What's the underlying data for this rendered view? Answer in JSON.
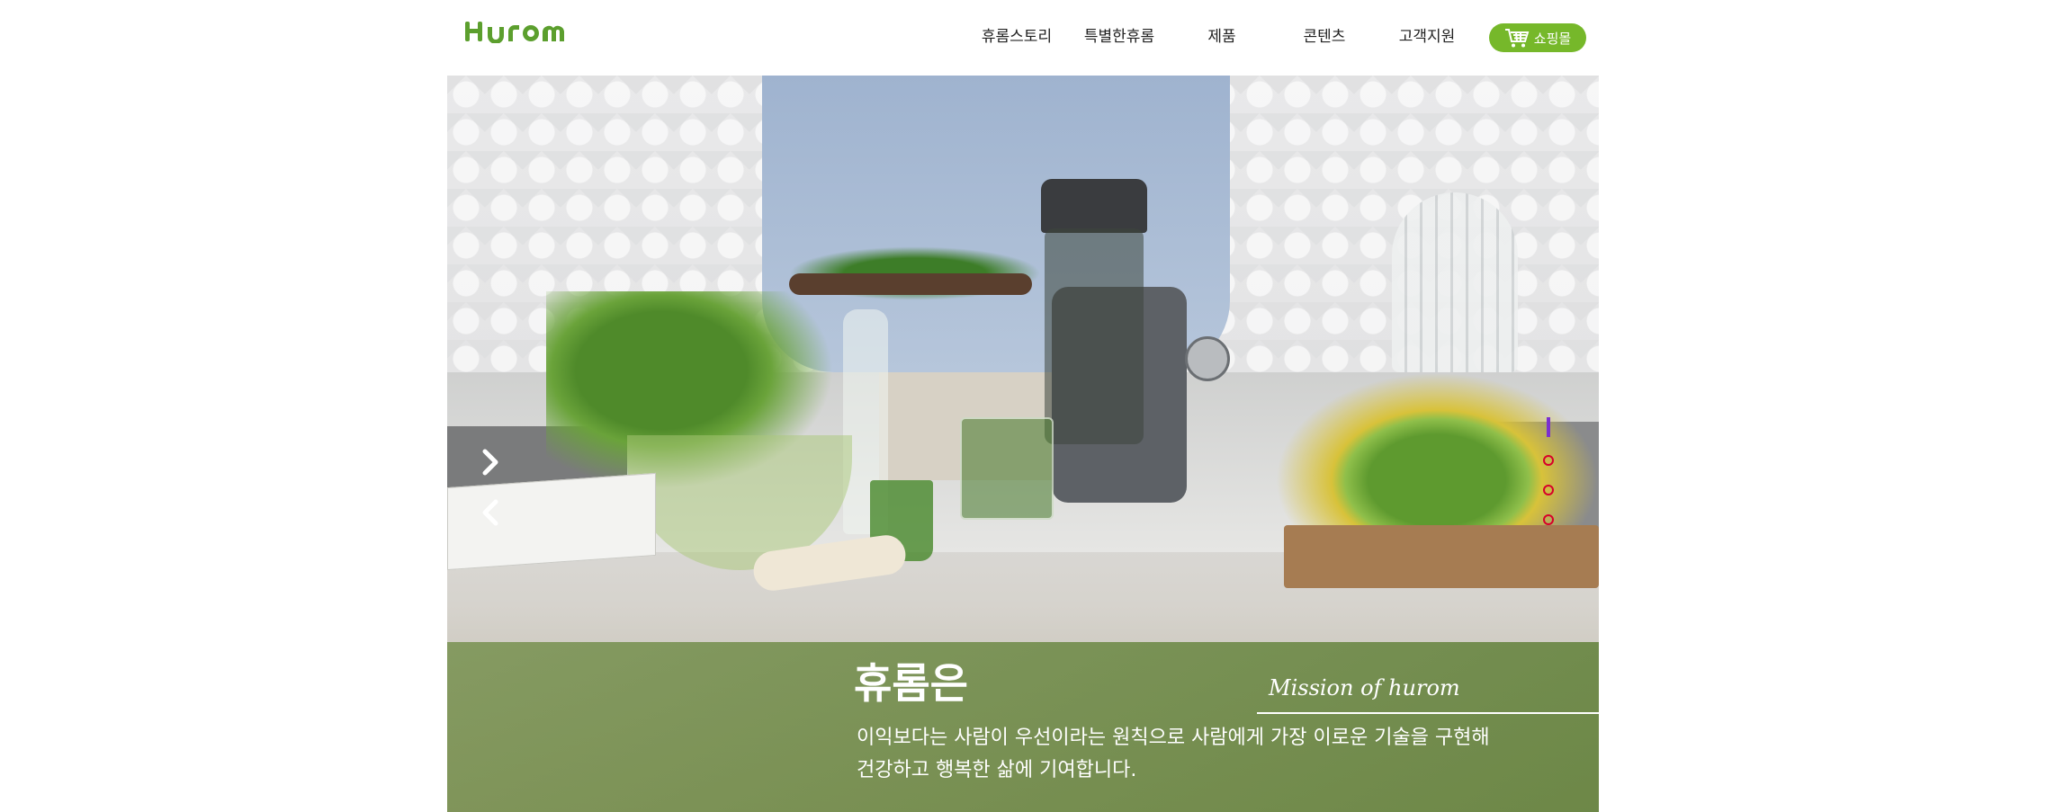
{
  "brand": {
    "logo_text": "HUROM",
    "accent_color": "#76b82a",
    "logo_color": "#5c9f2e"
  },
  "nav": {
    "items": [
      {
        "label": "휴롬스토리"
      },
      {
        "label": "특별한휴롬"
      },
      {
        "label": "제품"
      },
      {
        "label": "콘텐츠"
      },
      {
        "label": "고객지원"
      }
    ],
    "shop": {
      "label": "쇼핑몰",
      "icon": "cart-icon"
    }
  },
  "hero": {
    "title": "휴롬은",
    "line1": "이익보다는 사람이 우선이라는 원칙으로 사람에게 가장 이로운 기술을 구현해",
    "line2": "건강하고 행복한 삶에 기여합니다.",
    "mission": "Mission of hurom",
    "controls": {
      "next_icon": "chevron-right-icon",
      "prev_icon": "chevron-left-icon"
    },
    "pager": {
      "total": 4,
      "active": 1,
      "active_color": "#7a2fd0",
      "dot_color": "#d7002a"
    }
  }
}
